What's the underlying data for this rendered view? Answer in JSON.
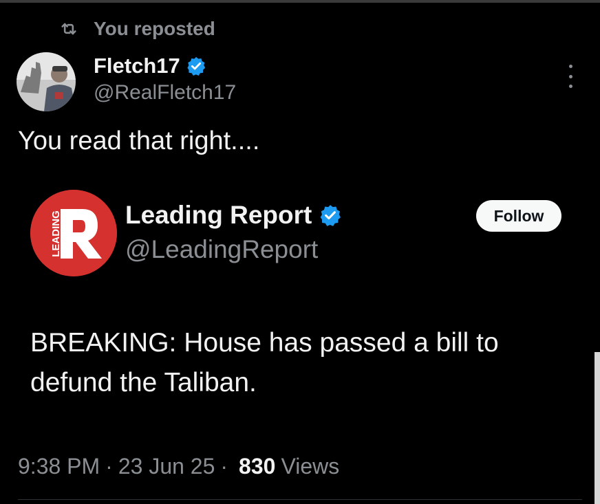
{
  "repost": {
    "label": "You reposted",
    "icon": "repost-icon"
  },
  "author": {
    "display_name": "Fletch17",
    "handle": "@RealFletch17",
    "verified": true,
    "badge_color": "#1d9bf0"
  },
  "tweet_text": "You read that right....",
  "quoted": {
    "logo_text": "LEADING",
    "logo_letter": "R",
    "logo_color": "#d5322f",
    "display_name": "Leading Report",
    "handle": "@LeadingReport",
    "verified": true,
    "follow_label": "Follow",
    "body": "BREAKING: House has passed a bill to defund the Taliban."
  },
  "meta": {
    "time": "9:38 PM",
    "separator": "·",
    "date": "23 Jun 25",
    "views_count": "830",
    "views_label": "Views"
  }
}
